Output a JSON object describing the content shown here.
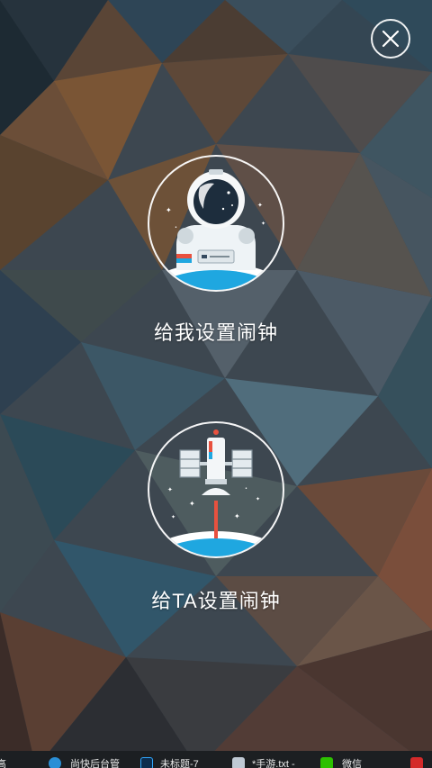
{
  "close": {
    "icon": "close-icon"
  },
  "options": [
    {
      "label": "给我设置闹钟",
      "illustration": "astronaut-icon"
    },
    {
      "label": "给TA设置闹钟",
      "illustration": "satellite-icon"
    }
  ],
  "taskbar": {
    "items": [
      {
        "label": "高"
      },
      {
        "label": "尚快后台管",
        "icon": "browser-icon"
      },
      {
        "label": "未标题-7",
        "icon": "photoshop-icon"
      },
      {
        "label": "*手游.txt -",
        "icon": "notepad-icon"
      },
      {
        "label": "微信",
        "icon": "wechat-icon"
      }
    ]
  },
  "colors": {
    "planet": "#1fa7e0",
    "accent_red": "#e8513f",
    "text": "#ffffff"
  }
}
